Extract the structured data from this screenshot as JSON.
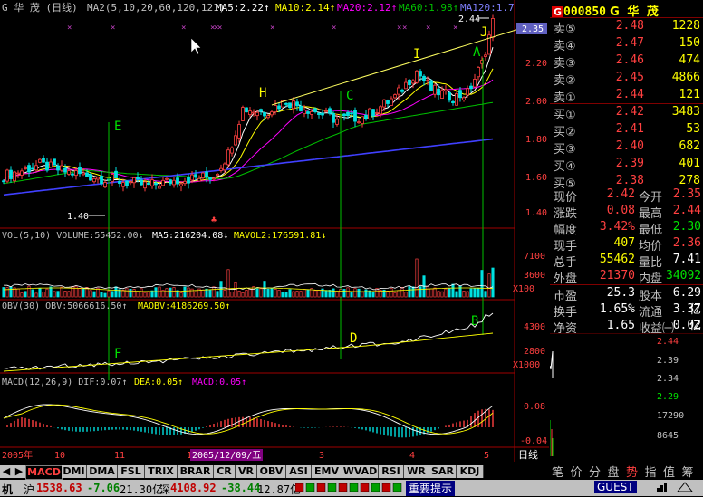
{
  "header": {
    "stock_label": "G 华 茂 (日线)",
    "ma_label": "MA2(5,10,20,60,120,121)",
    "ma5": "MA5:2.22↑",
    "ma10": "MA10:2.14↑",
    "ma20": "MA20:2.12↑",
    "ma60": "MA60:1.98↑",
    "ma120": "MA120:1.7"
  },
  "price_labels": {
    "high_marker": "2.44",
    "low_marker": "1.40",
    "current_box": "2.35"
  },
  "annotations": {
    "E": "E",
    "F": "F",
    "H": "H",
    "C": "C",
    "D": "D",
    "I": "I",
    "A": "A",
    "J": "J",
    "B": "B"
  },
  "volume_header": {
    "label": "VOL(5,10) VOLUME:55452.00↓",
    "ma5": "MA5:216204.08↓",
    "mavol2": "MAVOL2:176591.81↓"
  },
  "obv_header": {
    "label": "OBV(30) OBV:5066616.50↑",
    "maobv": "MAOBV:4186269.50↑"
  },
  "macd_header": {
    "label": "MACD(12,26,9) DIF:0.07↑",
    "dea": "DEA:0.05↑",
    "macd": "MACD:0.05↑"
  },
  "y_axis": {
    "price": [
      "2.20",
      "2.00",
      "1.80",
      "1.60",
      "1.40"
    ],
    "volume": [
      "7100",
      "3600",
      "X100"
    ],
    "obv": [
      "4300",
      "2800",
      "X1000"
    ],
    "macd": [
      "0.08",
      "-0.04"
    ]
  },
  "x_axis": {
    "labels": [
      "2005年",
      "10",
      "11",
      "1",
      "3",
      "4",
      "5"
    ],
    "date_box": "2005/12/09/五",
    "period": "日线"
  },
  "right_panel": {
    "g_badge": "G",
    "code": "000850",
    "name": "G 华 茂",
    "sell": [
      {
        "label": "卖⑤",
        "price": "2.48",
        "vol": "1228"
      },
      {
        "label": "卖④",
        "price": "2.47",
        "vol": "150"
      },
      {
        "label": "卖③",
        "price": "2.46",
        "vol": "474"
      },
      {
        "label": "卖②",
        "price": "2.45",
        "vol": "4866"
      },
      {
        "label": "卖①",
        "price": "2.44",
        "vol": "121"
      }
    ],
    "buy": [
      {
        "label": "买①",
        "price": "2.42",
        "vol": "3483"
      },
      {
        "label": "买②",
        "price": "2.41",
        "vol": "53"
      },
      {
        "label": "买③",
        "price": "2.40",
        "vol": "682"
      },
      {
        "label": "买④",
        "price": "2.39",
        "vol": "401"
      },
      {
        "label": "买⑤",
        "price": "2.38",
        "vol": "278"
      }
    ],
    "quote": [
      {
        "l1": "现价",
        "v1": "2.42",
        "l2": "今开",
        "v2": "2.35"
      },
      {
        "l1": "涨跌",
        "v1": "0.08",
        "l2": "最高",
        "v2": "2.44"
      },
      {
        "l1": "幅度",
        "v1": "3.42%",
        "l2": "最低",
        "v2": "2.30"
      },
      {
        "l1": "现手",
        "v1": "407",
        "l2": "均价",
        "v2": "2.36"
      },
      {
        "l1": "总手",
        "v1": "55462",
        "l2": "量比",
        "v2": "7.41"
      },
      {
        "l1": "外盘",
        "v1": "21370",
        "l2": "内盘",
        "v2": "34092"
      }
    ],
    "fin": [
      {
        "l1": "市盈",
        "v1": "25.3",
        "l2": "股本",
        "v2": "6.29亿"
      },
      {
        "l1": "换手",
        "v1": "1.65%",
        "l2": "流通",
        "v2": "3.37亿"
      },
      {
        "l1": "净资",
        "v1": "1.65",
        "l2": "收益㈠",
        "v2": "0.02"
      }
    ],
    "ticks_prices": [
      "2.44",
      "2.39",
      "2.34",
      "2.29"
    ],
    "ticks_vols": [
      "17290",
      "8645"
    ],
    "tabs": [
      "笔",
      "价",
      "分",
      "盘",
      "势",
      "指",
      "值",
      "筹"
    ]
  },
  "indicator_tabs": [
    "MACD",
    "DMI",
    "DMA",
    "FSL",
    "TRIX",
    "BRAR",
    "CR",
    "VR",
    "OBV",
    "ASI",
    "EMV",
    "WVAD",
    "RSI",
    "WR",
    "SAR",
    "KDJ"
  ],
  "status_bar": {
    "machine": "机",
    "sh_label": "沪",
    "sh_index": "1538.63",
    "sh_change": "-7.06",
    "sh_amount": "21.30亿",
    "sz_label": "深",
    "sz_index": "4108.92",
    "sz_change": "-38.44",
    "sz_amount": "12.87亿",
    "notice": "重要提示",
    "user": "GUEST"
  },
  "colors": {
    "up": "#ff4040",
    "down": "#00e0e0",
    "ma5": "#ffffff",
    "ma10": "#ffff00",
    "ma20": "#ff00ff",
    "ma60": "#00c000",
    "ma120": "#4040ff"
  }
}
